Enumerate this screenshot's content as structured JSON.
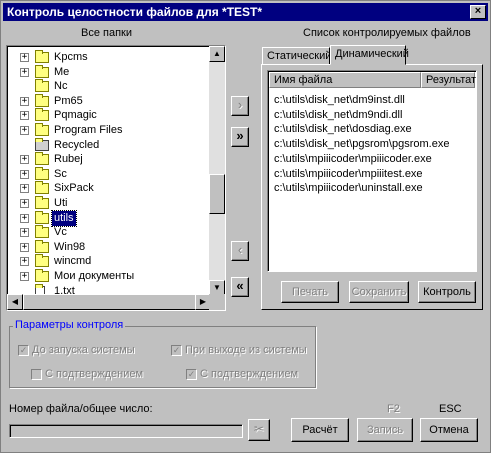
{
  "window": {
    "title": "Контроль целостности файлов для *TEST*",
    "close_glyph": "×"
  },
  "left_panel": {
    "heading": "Все папки",
    "items": [
      {
        "label": "Kpcms",
        "expander": "+",
        "icon": "folder-icon"
      },
      {
        "label": "Me",
        "expander": "+",
        "icon": "folder-icon"
      },
      {
        "label": "Nc",
        "expander": "",
        "icon": "folder-icon"
      },
      {
        "label": "Pm65",
        "expander": "+",
        "icon": "folder-icon"
      },
      {
        "label": "Pqmagic",
        "expander": "+",
        "icon": "folder-icon"
      },
      {
        "label": "Program Files",
        "expander": "+",
        "icon": "folder-icon"
      },
      {
        "label": "Recycled",
        "expander": "",
        "icon": "recycle-bin-icon"
      },
      {
        "label": "Rubej",
        "expander": "+",
        "icon": "folder-icon"
      },
      {
        "label": "Sc",
        "expander": "+",
        "icon": "folder-icon"
      },
      {
        "label": "SixPack",
        "expander": "+",
        "icon": "folder-icon"
      },
      {
        "label": "Uti",
        "expander": "+",
        "icon": "folder-icon"
      },
      {
        "label": "utils",
        "expander": "+",
        "icon": "folder-icon",
        "selected": true
      },
      {
        "label": "Vc",
        "expander": "+",
        "icon": "folder-icon"
      },
      {
        "label": "Win98",
        "expander": "+",
        "icon": "folder-icon"
      },
      {
        "label": "wincmd",
        "expander": "+",
        "icon": "folder-icon"
      },
      {
        "label": "Мои документы",
        "expander": "+",
        "icon": "folder-icon"
      },
      {
        "label": "1.txt",
        "expander": "",
        "icon": "file-icon"
      }
    ]
  },
  "transfer_buttons": {
    "add": "›",
    "add_all": "»",
    "remove": "‹",
    "remove_all": "«"
  },
  "right_panel": {
    "heading": "Список контролируемых файлов",
    "tabs": [
      {
        "label": "Статический",
        "active": false
      },
      {
        "label": "Динамический",
        "active": true
      }
    ],
    "columns": [
      "Имя файла",
      "Результат"
    ],
    "rows": [
      "c:\\utils\\disk_net\\dm9inst.dll",
      "c:\\utils\\disk_net\\dm9ndi.dll",
      "c:\\utils\\disk_net\\dosdiag.exe",
      "c:\\utils\\disk_net\\pgsrom\\pgsrom.exe",
      "c:\\utils\\mpiiicoder\\mpiiicoder.exe",
      "c:\\utils\\mpiiicoder\\mpiiitest.exe",
      "c:\\utils\\mpiiicoder\\uninstall.exe"
    ],
    "buttons": {
      "print": "Печать",
      "save": "Сохранить",
      "control": "Контроль"
    }
  },
  "params": {
    "title": "Параметры контроля",
    "on_boot": "До запуска системы",
    "on_exit": "При выходе из системы",
    "confirm1": "С подтверждением",
    "confirm2": "С подтверждением"
  },
  "footer": {
    "file_counter_label": "Номер файла/общее число:",
    "f2_hint": "F2",
    "esc_hint": "ESC",
    "calc": "Расчёт",
    "write": "Запись",
    "cancel": "Отмена"
  },
  "progress": {
    "value": 0
  }
}
